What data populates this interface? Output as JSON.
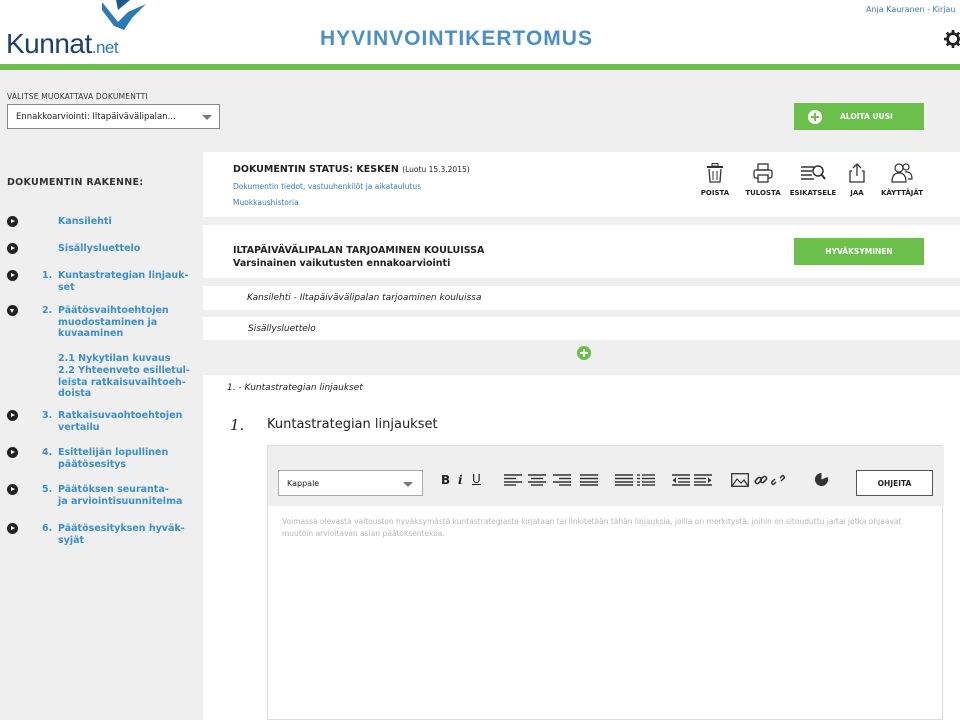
{
  "header": {
    "logo_text": "Kunnat",
    "logo_suffix": ".net",
    "title": "HYVINVOINTIKERTOMUS",
    "user": "Anja Kauranen - Kirjau",
    "icons": {
      "settings": "gear-icon",
      "logo_bird": "bird-logo-icon"
    },
    "accent_color": "#6ac04a"
  },
  "doc_select": {
    "label": "VALITSE MUOKATTAVA DOKUMENTTI",
    "value": "Ennakkoarviointi: Iltapäivävälipalan..."
  },
  "start_new_button": "ALOITA UUSI",
  "sidebar": {
    "title": "DOKUMENTIN RAKENNE:",
    "items": [
      {
        "num": "",
        "label": "Kansilehti"
      },
      {
        "num": "",
        "label": "Sisällysluettelo"
      },
      {
        "num": "1.",
        "label": "Kuntastrategian linjauk-\nset"
      },
      {
        "num": "2.",
        "label": "Päätösvaihtoehtojen\nmuodostaminen ja\nkuvaaminen"
      },
      {
        "num": "3.",
        "label": "Ratkaisuvaohtoehtojen\nvertailu"
      },
      {
        "num": "4.",
        "label": "Esittelijän lopullinen\npäätösesitys"
      },
      {
        "num": "5.",
        "label": "Päätöksen seuranta-\nja arviointisuunnitelma"
      },
      {
        "num": "6.",
        "label": "Päätösesityksen hyväk-\nsyjät"
      }
    ],
    "subitems": [
      "2.1 Nykytilan kuvaus",
      "2.2 Yhteenveto esilletul-\nleista ratkaisuvaihtoeh-\ndoista"
    ]
  },
  "status": {
    "title": "DOKUMENTIN STATUS: KESKEN",
    "saved": "(Luotu 15.3.2015)",
    "info_link": "Dokumentin tiedot, vastuuhenkilöt ja aikataulutus",
    "history_link": "Muokkaushistoria",
    "tools": [
      {
        "label": "POISTA",
        "icon": "trash-icon"
      },
      {
        "label": "TULOSTA",
        "icon": "printer-icon"
      },
      {
        "label": "ESIKATSELE",
        "icon": "preview-icon"
      },
      {
        "label": "JAA",
        "icon": "share-icon"
      },
      {
        "label": "KÄYTTÄJÄT",
        "icon": "users-icon"
      }
    ]
  },
  "section": {
    "title": "ILTAPÄIVÄVÄLIPALAN TARJOAMINEN KOULUISSA",
    "subtitle": "Varsinainen vaikutusten ennakoarviointi",
    "approve_button": "HYVÄKSYMINEN"
  },
  "rows": {
    "cover": "Kansilehti - Iltapäivävälipalan tarjoaminen kouluissa",
    "toc": "Sisällysluettelo"
  },
  "content": {
    "crumb": "1. - Kuntastrategian linjaukset",
    "heading_num": "1.",
    "heading": "Kuntastrategian linjaukset"
  },
  "editor": {
    "style_value": "Kappale",
    "bold": "B",
    "italic": "i",
    "underline": "U",
    "help_button": "OHJEITA",
    "placeholder": "Voimassa olevasta valtouston hyväksymästä kuntastrategiasta kirjataan tai linkitetään tähän linjauksia, joilla on merkitystä, joihin on sitouduttu ja/tai jotka ohjaavat muutoin arvioitavan asian päätöksentekoa."
  }
}
